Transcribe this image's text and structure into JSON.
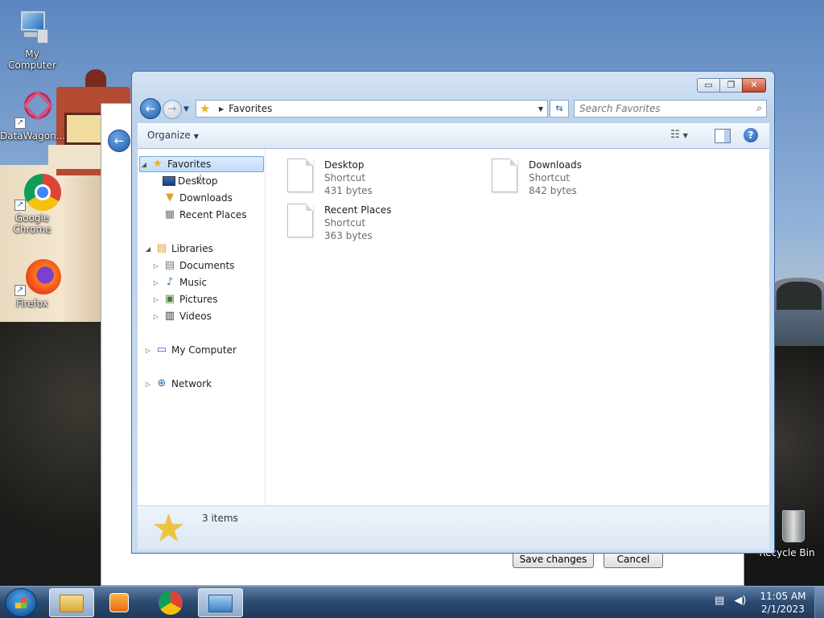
{
  "desktop": {
    "icons": [
      {
        "label": "My Computer"
      },
      {
        "label": "DataWagon..."
      },
      {
        "label": "Google Chrome"
      },
      {
        "label": "Firefox"
      },
      {
        "label": "Recycle Bin"
      }
    ]
  },
  "background_dialog": {
    "save_label": "Save changes",
    "cancel_label": "Cancel"
  },
  "window": {
    "caption": {
      "min": "▭",
      "max": "❐",
      "close": "✕"
    },
    "address": {
      "location": "Favorites"
    },
    "search": {
      "placeholder": "Search Favorites"
    },
    "toolbar": {
      "organize_label": "Organize"
    },
    "nav": {
      "favorites": "Favorites",
      "desktop": "Desktop",
      "downloads": "Downloads",
      "recent_places": "Recent Places",
      "libraries": "Libraries",
      "documents": "Documents",
      "music": "Music",
      "pictures": "Pictures",
      "videos": "Videos",
      "my_computer": "My Computer",
      "network": "Network"
    },
    "files": [
      {
        "name": "Desktop",
        "type": "Shortcut",
        "size": "431 bytes"
      },
      {
        "name": "Downloads",
        "type": "Shortcut",
        "size": "842 bytes"
      },
      {
        "name": "Recent Places",
        "type": "Shortcut",
        "size": "363 bytes"
      }
    ],
    "status": {
      "count": "3 items"
    }
  },
  "taskbar": {
    "time": "11:05 AM",
    "date": "2/1/2023"
  }
}
